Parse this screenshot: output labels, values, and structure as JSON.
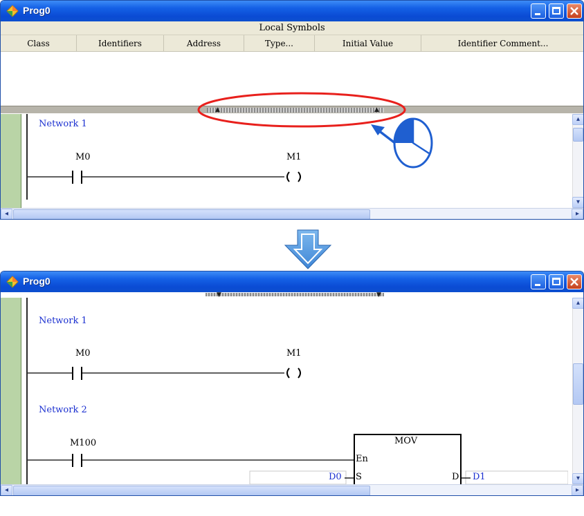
{
  "window_top": {
    "title": "Prog0",
    "local_symbols_title": "Local Symbols",
    "columns": [
      "Class",
      "Identifiers",
      "Address",
      "Type...",
      "Initial Value",
      "Identifier Comment..."
    ],
    "network1": {
      "label": "Network 1",
      "contact": "M0",
      "coil": "M1"
    }
  },
  "window_bottom": {
    "title": "Prog0",
    "network1": {
      "label": "Network 1",
      "contact": "M0",
      "coil": "M1"
    },
    "network2": {
      "label": "Network 2",
      "contact": "M100",
      "block": {
        "name": "MOV",
        "pin_en": "En",
        "pin_s": "S",
        "pin_d": "D",
        "input_s": "D0",
        "output_d": "D1"
      }
    }
  },
  "colors": {
    "title_bar": "#0a4bd4",
    "highlight_ellipse": "#e8201c",
    "network_label": "#1a2fd0",
    "left_rail": "#b9d4a6",
    "arrow": "#5aa0e0"
  },
  "icons": [
    "program-icon",
    "minimize-icon",
    "maximize-icon",
    "close-icon",
    "mouse-icon",
    "pointer-arrow-icon",
    "down-arrow-icon"
  ]
}
